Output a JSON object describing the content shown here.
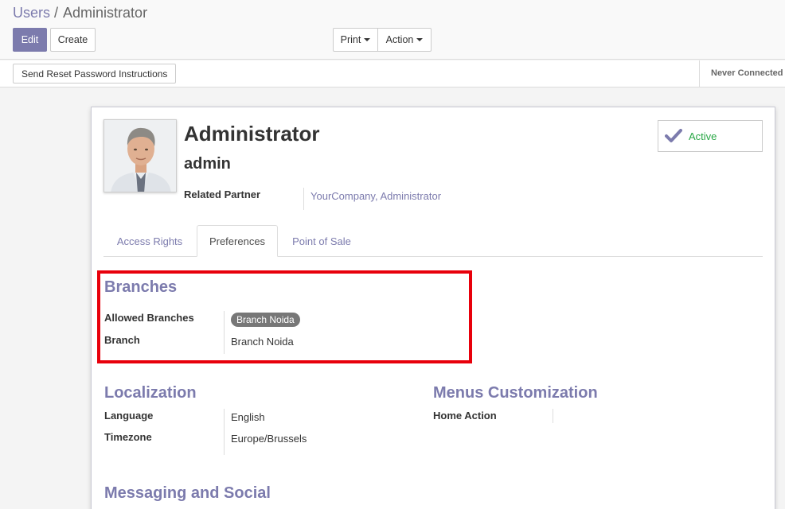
{
  "breadcrumb": {
    "parent": "Users",
    "separator": "/",
    "current": "Administrator"
  },
  "buttons": {
    "edit": "Edit",
    "create": "Create",
    "print": "Print",
    "action": "Action",
    "reset_password": "Send Reset Password Instructions"
  },
  "status": {
    "connection": "Never Connected"
  },
  "user": {
    "name": "Administrator",
    "login": "admin",
    "related_partner_label": "Related Partner",
    "related_partner_value": "YourCompany, Administrator",
    "active_label": "Active"
  },
  "tabs": [
    {
      "label": "Access Rights",
      "active": false
    },
    {
      "label": "Preferences",
      "active": true
    },
    {
      "label": "Point of Sale",
      "active": false
    }
  ],
  "branches": {
    "title": "Branches",
    "allowed_label": "Allowed Branches",
    "allowed_tags": [
      "Branch Noida"
    ],
    "branch_label": "Branch",
    "branch_value": "Branch Noida"
  },
  "localization": {
    "title": "Localization",
    "language_label": "Language",
    "language_value": "English",
    "timezone_label": "Timezone",
    "timezone_value": "Europe/Brussels"
  },
  "menus": {
    "title": "Menus Customization",
    "home_action_label": "Home Action",
    "home_action_value": ""
  },
  "messaging": {
    "title": "Messaging and Social"
  },
  "colors": {
    "primary": "#7c7bad",
    "active_green": "#28a745",
    "highlight_red": "#e8000b"
  },
  "icons": {
    "checkmark": "check-icon",
    "dropdown": "caret-down-icon"
  }
}
